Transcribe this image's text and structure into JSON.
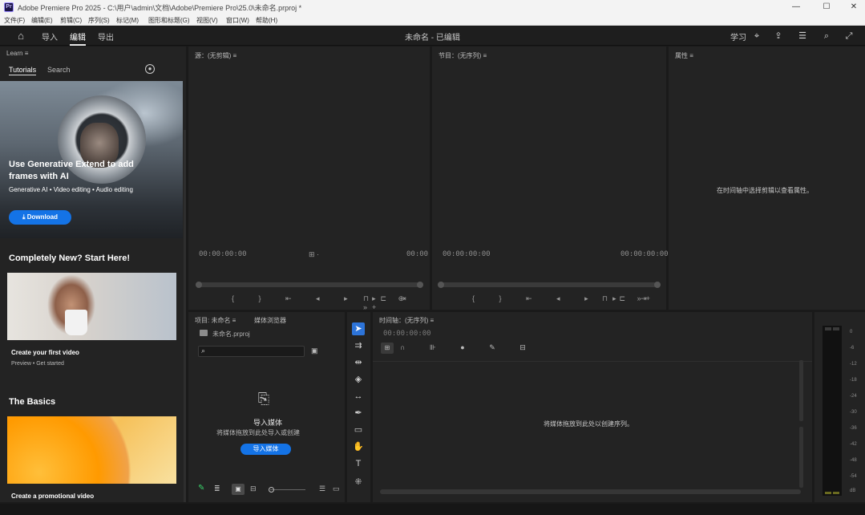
{
  "window": {
    "title": "Adobe Premiere Pro 2025 - C:\\用户\\admin\\文档\\Adobe\\Premiere Pro\\25.0\\未命名.prproj *",
    "app_icon": "Pr",
    "minimize": "—",
    "maximize": "☐",
    "close": "✕"
  },
  "menu": [
    "文件(F)",
    "编辑(E)",
    "剪辑(C)",
    "序列(S)",
    "标记(M)",
    "图形和标题(G)",
    "视图(V)",
    "窗口(W)",
    "帮助(H)"
  ],
  "header": {
    "tabs": [
      "导入",
      "编辑",
      "导出"
    ],
    "active_tab": "编辑",
    "center_title": "未命名 - 已编辑",
    "right_text": "学习"
  },
  "learn": {
    "panel_title": "Learn",
    "tabs": [
      "Tutorials",
      "Search"
    ],
    "hero": {
      "title": "Use Generative Extend to add frames with AI",
      "subtitle": "Generative AI  •  Video editing  •  Audio editing",
      "button": "Download"
    },
    "section1": "Completely New? Start Here!",
    "card1": {
      "caption": "Create your first video",
      "sub": "Preview  •  Get started"
    },
    "section2": "The Basics",
    "card2": {
      "caption": "Create a promotional video"
    }
  },
  "source_monitor": {
    "title": "源：(无剪辑)",
    "timecode_left": "00:00:00:00",
    "timecode_right": "00:00"
  },
  "program_monitor": {
    "title": "节目：(无序列)",
    "timecode_left": "00:00:00:00",
    "timecode_right": "00:00:00:00"
  },
  "properties": {
    "title": "属性",
    "message": "在时间轴中选择剪辑以查看属性。"
  },
  "project": {
    "title": "项目: 未命名",
    "tab2": "媒体浏览器",
    "file": "未命名.prproj",
    "import_title": "导入媒体",
    "import_sub": "将媒体拖放到此处导入或创建",
    "import_button": "导入媒体"
  },
  "timeline": {
    "title": "时间轴：(无序列)",
    "timecode": "00:00:00:00",
    "message": "将媒体拖放到此处以创建序列。"
  },
  "meter": {
    "labels": [
      "0",
      "-6",
      "-12",
      "-18",
      "-24",
      "-30",
      "-36",
      "-42",
      "-48",
      "-54",
      "dB"
    ]
  }
}
